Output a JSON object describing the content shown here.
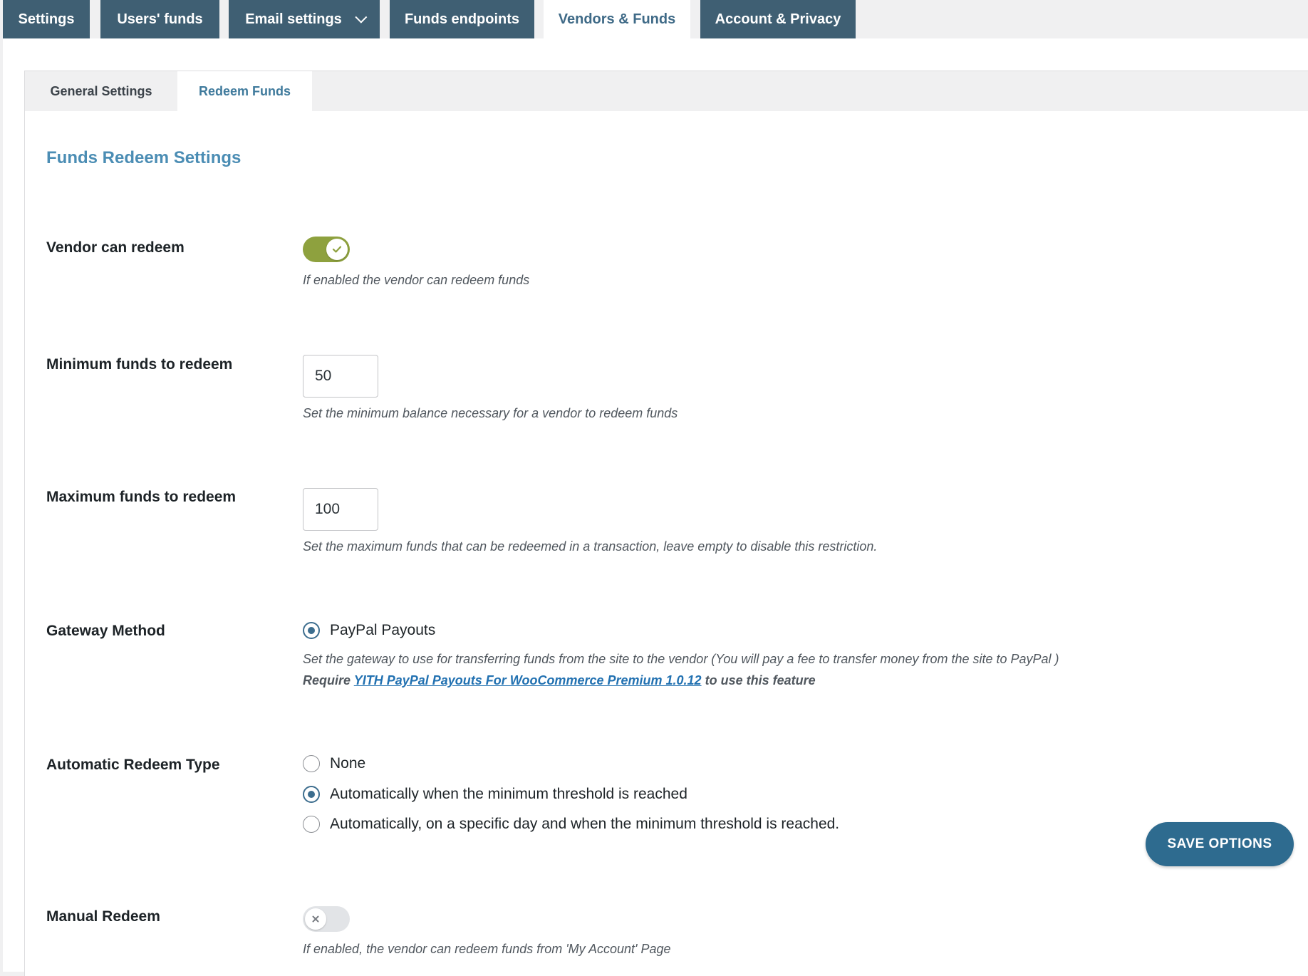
{
  "top_tabs": [
    {
      "label": "Settings"
    },
    {
      "label": "Users' funds"
    },
    {
      "label": "Email settings"
    },
    {
      "label": "Funds endpoints"
    },
    {
      "label": "Vendors & Funds"
    },
    {
      "label": "Account & Privacy"
    }
  ],
  "sub_tabs": [
    {
      "label": "General Settings"
    },
    {
      "label": "Redeem Funds"
    }
  ],
  "section_title": "Funds Redeem Settings",
  "vendor_can_redeem": {
    "label": "Vendor can redeem",
    "enabled": true,
    "description": "If enabled the vendor can redeem funds"
  },
  "minimum_funds": {
    "label": "Minimum funds to redeem",
    "value": "50",
    "description": "Set the minimum balance necessary for a vendor to redeem funds"
  },
  "maximum_funds": {
    "label": "Maximum funds to redeem",
    "value": "100",
    "description": "Set the maximum funds that can be redeemed in a transaction, leave empty to disable this restriction."
  },
  "gateway_method": {
    "label": "Gateway Method",
    "option": "PayPal Payouts",
    "description": "Set the gateway to use for transferring funds from the site to the vendor (You will pay a fee to transfer money from the site to PayPal )",
    "require_prefix": "Require",
    "require_link": "YITH PayPal Payouts For WooCommerce Premium 1.0.12",
    "require_suffix": "to use this feature"
  },
  "automatic_redeem": {
    "label": "Automatic Redeem Type",
    "options": [
      {
        "label": "None",
        "checked": false
      },
      {
        "label": "Automatically when the minimum threshold is reached",
        "checked": true
      },
      {
        "label": "Automatically, on a specific day and when the minimum threshold is reached.",
        "checked": false
      }
    ]
  },
  "manual_redeem": {
    "label": "Manual Redeem",
    "enabled": false,
    "description": "If enabled, the vendor can redeem funds from 'My Account' Page"
  },
  "save_button": "SAVE OPTIONS",
  "colors": {
    "tab_bg": "#3f5f73",
    "accent": "#4b8db4",
    "toggle_on": "#8ea13e",
    "button": "#2e6b8f"
  }
}
